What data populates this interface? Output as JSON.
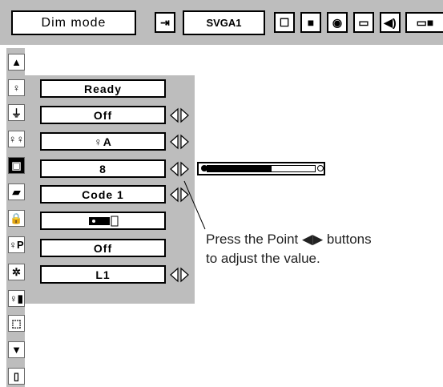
{
  "toolbar": {
    "mode_label": "Dim mode",
    "input_label": "SVGA1",
    "icons": [
      "input-icon",
      "pc-adjust-icon",
      "image-select-icon",
      "image-adjust-icon",
      "screen-icon",
      "sound-icon",
      "setting-icon"
    ]
  },
  "sidebar": {
    "icons": [
      "up-arrow-icon",
      "lamp-icon",
      "power-management-icon",
      "lamp-control-icon",
      "image-level-icon",
      "remote-control-icon",
      "key-lock-icon",
      "pin-code-lock-icon",
      "fan-control-icon",
      "lamp-counter-icon",
      "factory-default-icon",
      "down-arrow-icon",
      "exit-icon"
    ]
  },
  "menu": {
    "rows": [
      {
        "label": "Ready",
        "arrows": false
      },
      {
        "label": "Off",
        "arrows": true
      },
      {
        "label": "♀A",
        "arrows": true
      },
      {
        "label": "8",
        "arrows": true
      },
      {
        "label": "Code 1",
        "arrows": true
      },
      {
        "label": "",
        "arrows": false
      },
      {
        "label": "Off",
        "arrows": false
      },
      {
        "label": "L1",
        "arrows": true
      }
    ]
  },
  "slider": {
    "value": 8,
    "fraction": 0.6
  },
  "callout": {
    "line1": "Press the Point ◀▶ buttons",
    "line2": "to adjust the value."
  }
}
